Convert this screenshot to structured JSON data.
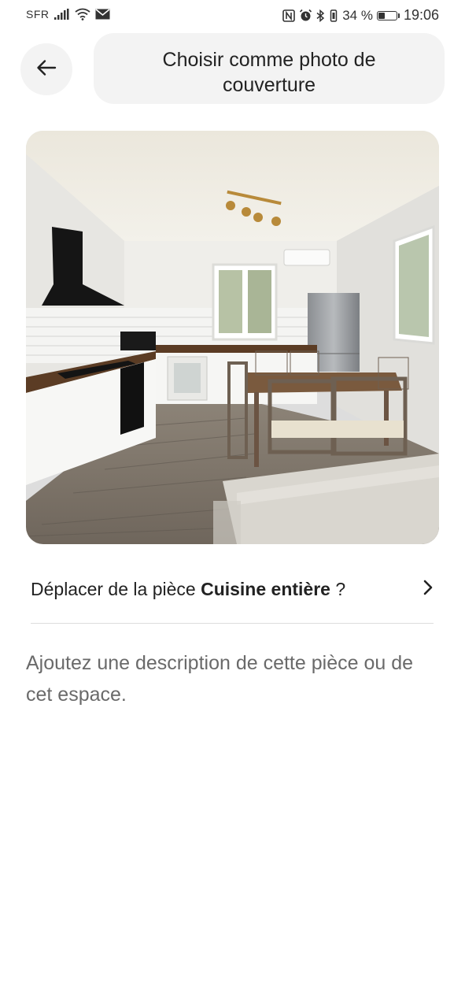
{
  "status_bar": {
    "carrier": "SFR",
    "battery_percent": "34 %",
    "battery_level": 0.34,
    "time": "19:06",
    "icons": [
      "signal-icon",
      "wifi-icon",
      "mail-icon",
      "nfc-icon",
      "alarm-icon",
      "bluetooth-icon",
      "vibrate-icon",
      "battery-icon"
    ]
  },
  "header": {
    "back_icon": "arrow-left-icon",
    "title": "Choisir comme photo de couverture"
  },
  "photo": {
    "subject": "kitchen-photo"
  },
  "move_room": {
    "prefix": "Déplacer de la pièce ",
    "room": "Cuisine entière",
    "suffix": " ?",
    "chevron_icon": "chevron-right-icon"
  },
  "description": {
    "placeholder": "Ajoutez une description de cette pièce ou de cet espace."
  }
}
